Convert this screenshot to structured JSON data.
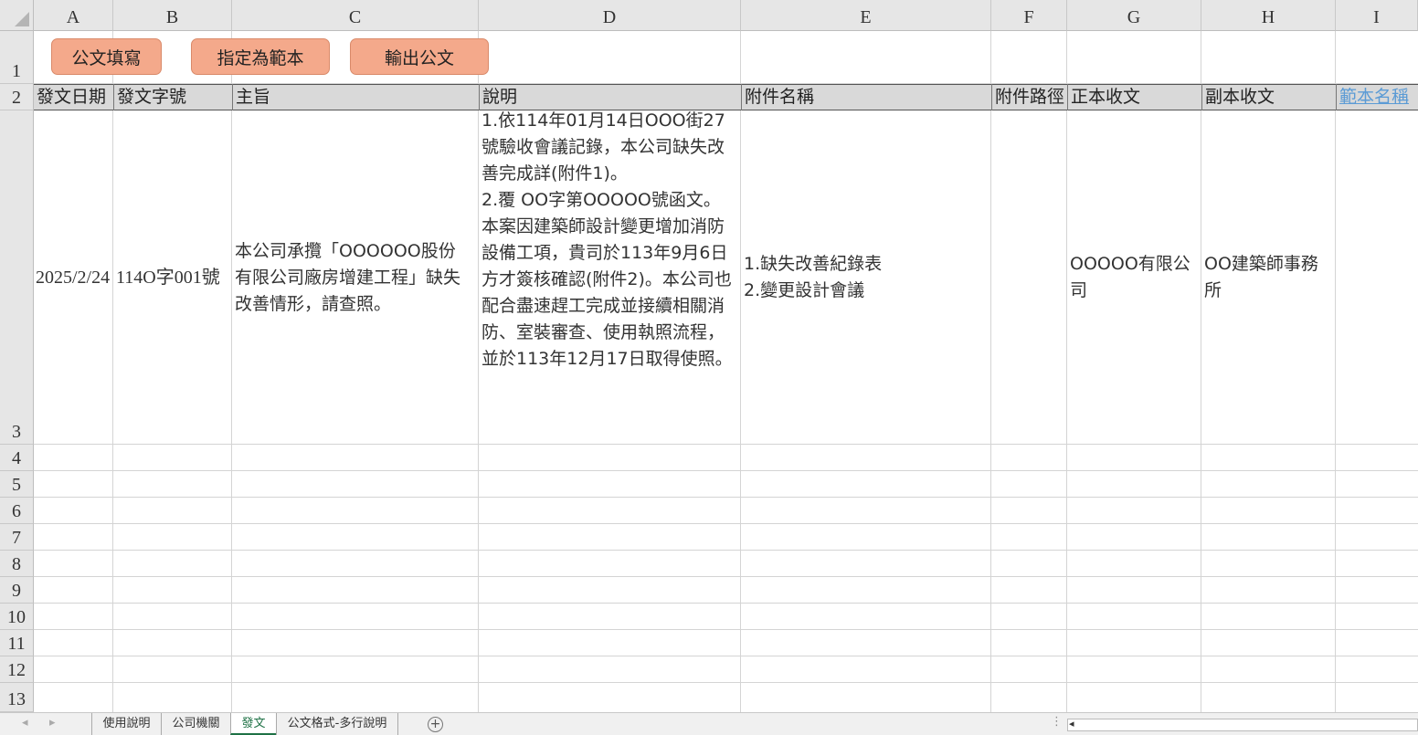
{
  "columns": [
    "A",
    "B",
    "C",
    "D",
    "E",
    "F",
    "G",
    "H",
    "I"
  ],
  "rows": [
    "1",
    "2",
    "3",
    "4",
    "5",
    "6",
    "7",
    "8",
    "9",
    "10",
    "11",
    "12",
    "13"
  ],
  "buttons": {
    "fill": "公文填寫",
    "set_template": "指定為範本",
    "export": "輸出公文"
  },
  "headers": {
    "a": "發文日期",
    "b": "發文字號",
    "c": "主旨",
    "d": "說明",
    "e": "附件名稱",
    "f": "附件路徑",
    "g": "正本收文",
    "h": "副本收文",
    "i": "範本名稱"
  },
  "record": {
    "date": "2025/2/24",
    "doc_no": "114O字001號",
    "subject": "本公司承攬「OOOOOO股份有限公司廠房增建工程」缺失改善情形，請查照。",
    "description": "1.依114年01月14日OOO街27號驗收會議記錄，本公司缺失改善完成詳(附件1)。\n2.覆 OO字第OOOOO號函文。本案因建築師設計變更增加消防設備工項，貴司於113年9月6日方才簽核確認(附件2)。本公司也配合盡速趕工完成並接續相關消防、室裝審查、使用執照流程，並於113年12月17日取得使照。",
    "attachments": "1.缺失改善紀錄表\n2.變更設計會議",
    "attachment_path": "",
    "main_recipient": "OOOOO有限公司",
    "cc_recipient": "OO建築師事務所",
    "template_name": ""
  },
  "sheet_tabs": [
    "使用說明",
    "公司機關",
    "發文",
    "公文格式-多行說明"
  ],
  "active_tab": "發文",
  "nav": {
    "prev": "◂",
    "next": "▸",
    "add": "+",
    "menu": "⋮",
    "scroll_left": "◂"
  },
  "colors": {
    "button_fill": "#f4a98b",
    "header_fill": "#d9d9d9",
    "active_tab_text": "#1e7145",
    "link": "#5b9bd5"
  }
}
